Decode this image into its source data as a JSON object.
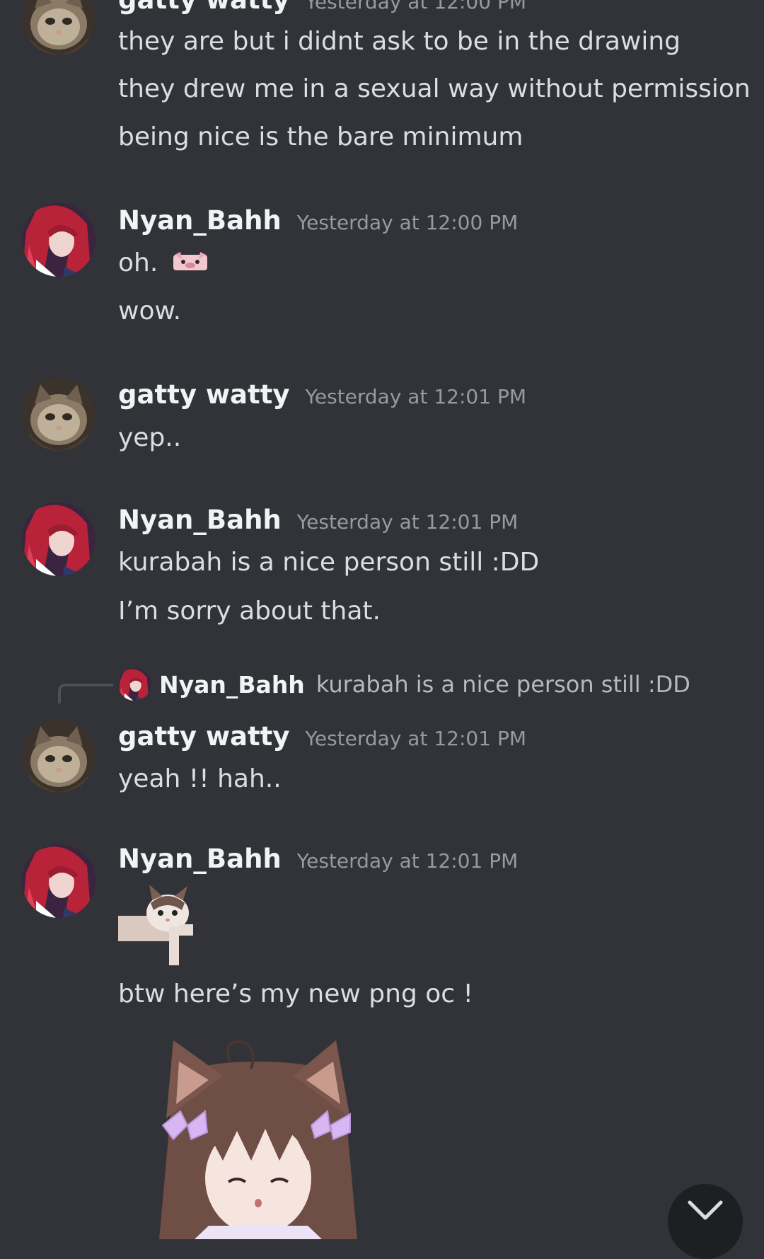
{
  "messages": [
    {
      "id": "m1",
      "author": "gatty watty",
      "timestamp": "Yesterday at 12:00 PM",
      "lines": [
        "they are but i didnt ask to be in the drawing",
        "they drew me in a sexual way without permission",
        "being nice is the bare minimum"
      ]
    },
    {
      "id": "m2",
      "author": "Nyan_Bahh",
      "timestamp": "Yesterday at 12:00 PM",
      "lines": [
        "oh.",
        "wow."
      ],
      "emoji": "pig-emoji"
    },
    {
      "id": "m3",
      "author": "gatty watty",
      "timestamp": "Yesterday at 12:01 PM",
      "lines": [
        "yep.."
      ]
    },
    {
      "id": "m4",
      "author": "Nyan_Bahh",
      "timestamp": "Yesterday at 12:01 PM",
      "lines": [
        "kurabah is a nice person still :DD",
        "I’m sorry about that."
      ]
    },
    {
      "id": "m5",
      "author": "gatty watty",
      "timestamp": "Yesterday at 12:01 PM",
      "reply": {
        "author": "Nyan_Bahh",
        "text": "kurabah is a nice person still :DD"
      },
      "lines": [
        "yeah !! hah.."
      ]
    },
    {
      "id": "m6",
      "author": "Nyan_Bahh",
      "timestamp": "Yesterday at 12:01 PM",
      "sticker": "cat-sticker",
      "lines": [
        "btw here’s my new png oc !"
      ],
      "image": "oc-character-image"
    }
  ],
  "scroll_button": {
    "icon": "chevron-down-icon"
  },
  "colors": {
    "background": "#313338",
    "username": "#f2f3f5",
    "timestamp": "#949ba4",
    "text": "#dbdee1",
    "reply_text": "#b5bac1"
  }
}
